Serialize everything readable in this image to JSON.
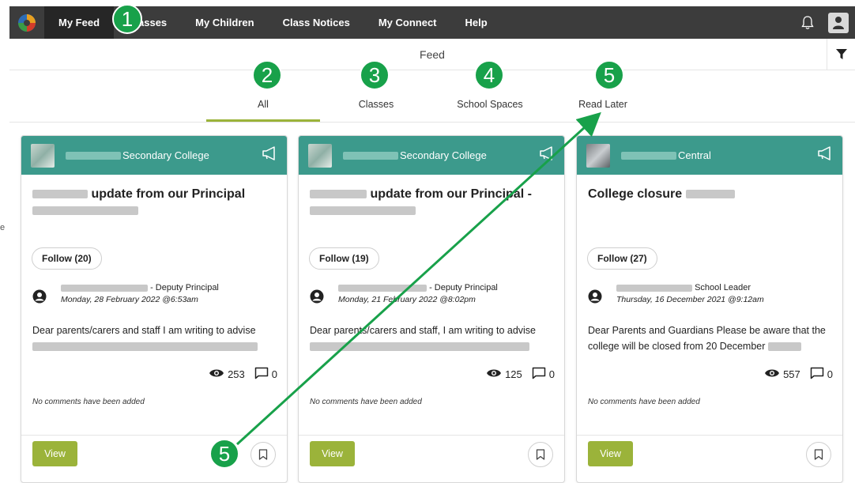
{
  "nav": {
    "items": [
      "My Feed",
      "Classes",
      "My Children",
      "Class Notices",
      "My Connect",
      "Help"
    ]
  },
  "feedbar": {
    "title": "Feed"
  },
  "tabs": [
    {
      "label": "All"
    },
    {
      "label": "Classes"
    },
    {
      "label": "School Spaces"
    },
    {
      "label": "Read Later"
    }
  ],
  "callouts": [
    "1",
    "2",
    "3",
    "4",
    "5",
    "5"
  ],
  "cards": [
    {
      "school": "Secondary College",
      "title": "update from our Principal",
      "follow": "Follow (20)",
      "role": "- Deputy Principal",
      "date": "Monday, 28 February 2022 @6:53am",
      "excerpt": "Dear parents/carers and staff  I am writing to advise",
      "views": "253",
      "comments": "0",
      "no_comments": "No comments have been added",
      "view_label": "View"
    },
    {
      "school": "Secondary College",
      "title": "update from our Principal -",
      "follow": "Follow (19)",
      "role": "- Deputy Principal",
      "date": "Monday, 21 February 2022 @8:02pm",
      "excerpt": "Dear parents/carers and staff,  I am writing to advise",
      "views": "125",
      "comments": "0",
      "no_comments": "No comments have been added",
      "view_label": "View"
    },
    {
      "school": "Central",
      "title": "College closure",
      "follow": "Follow (27)",
      "role": "School Leader",
      "date": "Thursday, 16 December 2021 @9:12am",
      "excerpt": "Dear Parents and Guardians Please be aware that the college will be closed from 20 December",
      "views": "557",
      "comments": "0",
      "no_comments": "No comments have been added",
      "view_label": "View"
    }
  ],
  "left_edge_text": "e",
  "colors": {
    "topbar": "#3c3c3c",
    "card_header": "#3c9a8c",
    "accent": "#9bb33a",
    "callout": "#18a14a"
  }
}
